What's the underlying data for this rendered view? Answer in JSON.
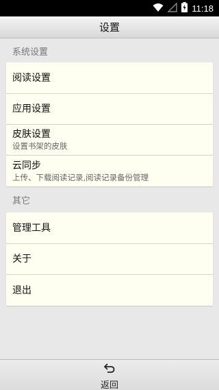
{
  "status_bar": {
    "time": "11:18",
    "icons": [
      "wifi-icon",
      "signal-off-icon",
      "battery-charging-icon"
    ]
  },
  "header": {
    "title": "设置"
  },
  "sections": [
    {
      "title": "系统设置",
      "items": [
        {
          "label": "阅读设置"
        },
        {
          "label": "应用设置"
        },
        {
          "label": "皮肤设置",
          "subtitle": "设置书架的皮肤"
        },
        {
          "label": "云同步",
          "subtitle": "上传、下载阅读记录,阅读记录备份管理"
        }
      ]
    },
    {
      "title": "其它",
      "items": [
        {
          "label": "管理工具"
        },
        {
          "label": "关于"
        },
        {
          "label": "退出"
        }
      ]
    }
  ],
  "bottom_bar": {
    "back_label": "返回",
    "back_icon": "back-arrow-icon"
  },
  "colors": {
    "card_background": "#fefff0",
    "page_background": "#e8e8e8",
    "section_header_text": "#777777"
  }
}
